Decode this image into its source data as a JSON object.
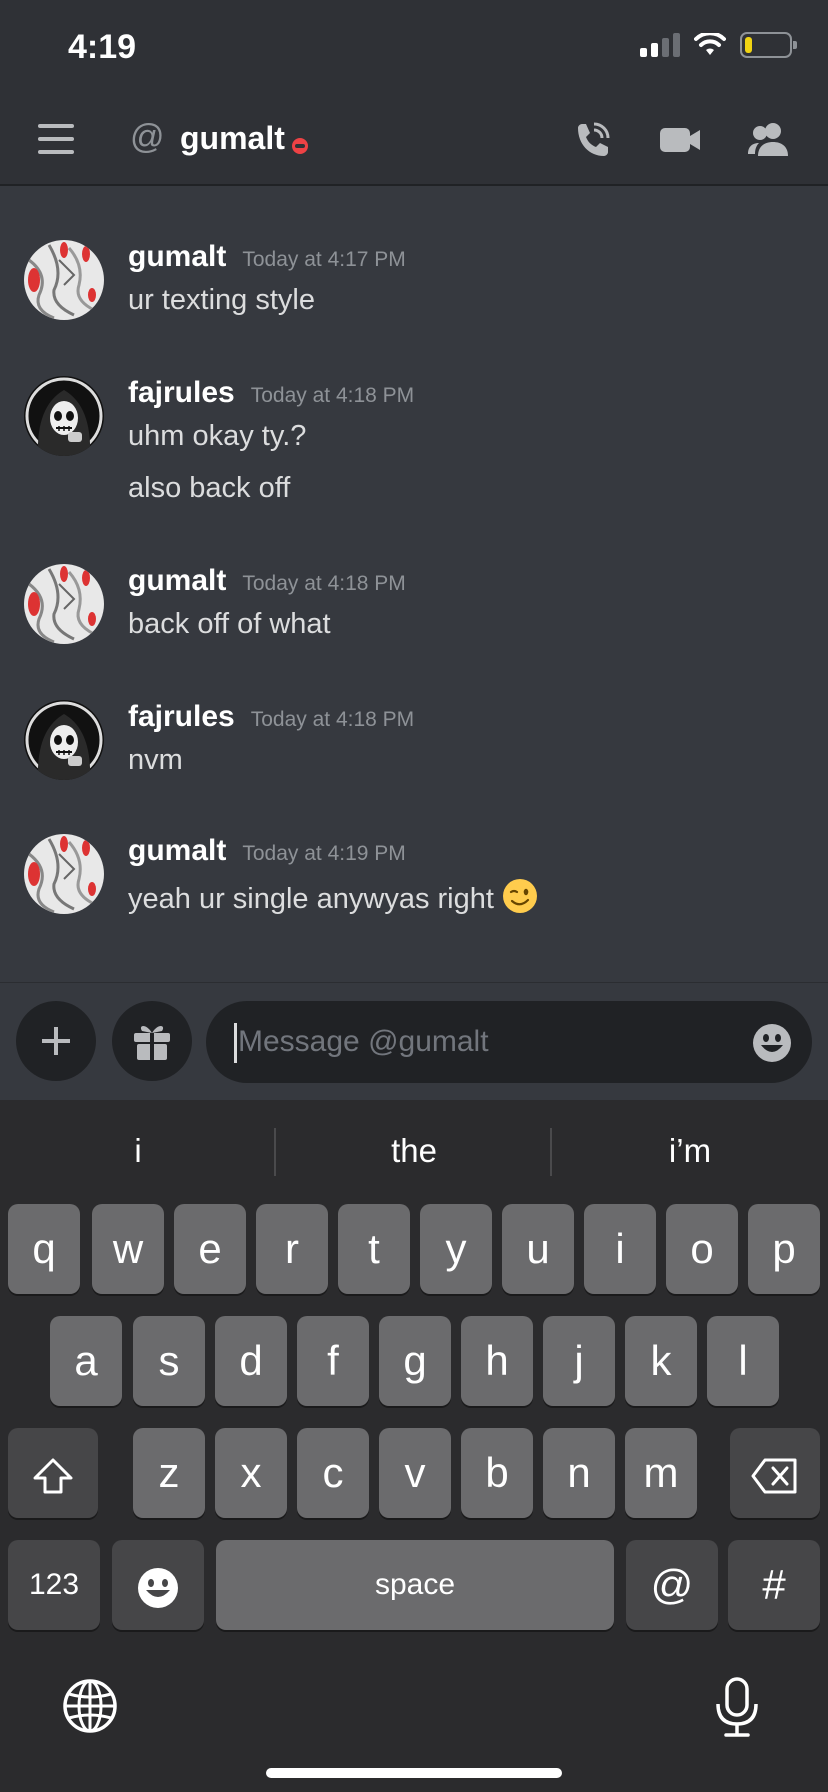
{
  "status_bar": {
    "time": "4:19"
  },
  "header": {
    "at_symbol": "@",
    "title": "gumalt"
  },
  "messages": [
    {
      "username": "gumalt",
      "timestamp": "Today at 4:17 PM",
      "lines": [
        "ur texting style"
      ]
    },
    {
      "username": "fajrules",
      "timestamp": "Today at 4:18 PM",
      "lines": [
        "uhm okay ty.?",
        "also back off"
      ]
    },
    {
      "username": "gumalt",
      "timestamp": "Today at 4:18 PM",
      "lines": [
        "back off of what"
      ]
    },
    {
      "username": "fajrules",
      "timestamp": "Today at 4:18 PM",
      "lines": [
        "nvm"
      ]
    },
    {
      "username": "gumalt",
      "timestamp": "Today at 4:19 PM",
      "lines": [
        "yeah ur single anywyas right"
      ]
    }
  ],
  "composer": {
    "placeholder": "Message @gumalt"
  },
  "keyboard": {
    "suggestions": [
      "i",
      "the",
      "i’m"
    ],
    "row1": [
      "q",
      "w",
      "e",
      "r",
      "t",
      "y",
      "u",
      "i",
      "o",
      "p"
    ],
    "row2": [
      "a",
      "s",
      "d",
      "f",
      "g",
      "h",
      "j",
      "k",
      "l"
    ],
    "row3": [
      "z",
      "x",
      "c",
      "v",
      "b",
      "n",
      "m"
    ],
    "numbers_label": "123",
    "space_label": "space",
    "at_label": "@",
    "hash_label": "#"
  },
  "colors": {
    "background": "#36393f",
    "header": "#2f3136",
    "input": "#202225",
    "status_dnd": "#ed4245",
    "battery_low": "#f0d313"
  }
}
